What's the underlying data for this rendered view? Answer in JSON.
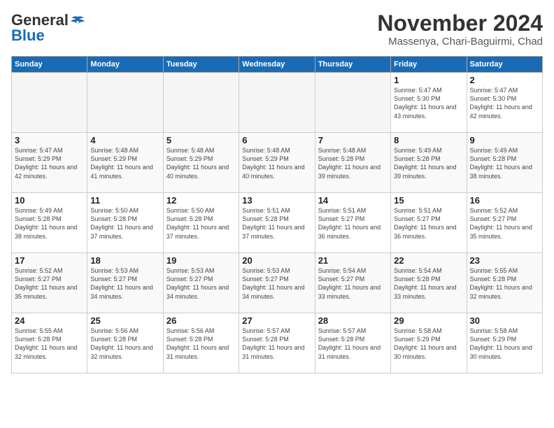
{
  "header": {
    "logo_general": "General",
    "logo_blue": "Blue",
    "title": "November 2024",
    "location": "Massenya, Chari-Baguirmi, Chad"
  },
  "days_of_week": [
    "Sunday",
    "Monday",
    "Tuesday",
    "Wednesday",
    "Thursday",
    "Friday",
    "Saturday"
  ],
  "weeks": [
    [
      {
        "day": "",
        "detail": ""
      },
      {
        "day": "",
        "detail": ""
      },
      {
        "day": "",
        "detail": ""
      },
      {
        "day": "",
        "detail": ""
      },
      {
        "day": "",
        "detail": ""
      },
      {
        "day": "1",
        "detail": "Sunrise: 5:47 AM\nSunset: 5:30 PM\nDaylight: 11 hours and 43 minutes."
      },
      {
        "day": "2",
        "detail": "Sunrise: 5:47 AM\nSunset: 5:30 PM\nDaylight: 11 hours and 42 minutes."
      }
    ],
    [
      {
        "day": "3",
        "detail": "Sunrise: 5:47 AM\nSunset: 5:29 PM\nDaylight: 11 hours and 42 minutes."
      },
      {
        "day": "4",
        "detail": "Sunrise: 5:48 AM\nSunset: 5:29 PM\nDaylight: 11 hours and 41 minutes."
      },
      {
        "day": "5",
        "detail": "Sunrise: 5:48 AM\nSunset: 5:29 PM\nDaylight: 11 hours and 40 minutes."
      },
      {
        "day": "6",
        "detail": "Sunrise: 5:48 AM\nSunset: 5:29 PM\nDaylight: 11 hours and 40 minutes."
      },
      {
        "day": "7",
        "detail": "Sunrise: 5:48 AM\nSunset: 5:28 PM\nDaylight: 11 hours and 39 minutes."
      },
      {
        "day": "8",
        "detail": "Sunrise: 5:49 AM\nSunset: 5:28 PM\nDaylight: 11 hours and 39 minutes."
      },
      {
        "day": "9",
        "detail": "Sunrise: 5:49 AM\nSunset: 5:28 PM\nDaylight: 11 hours and 38 minutes."
      }
    ],
    [
      {
        "day": "10",
        "detail": "Sunrise: 5:49 AM\nSunset: 5:28 PM\nDaylight: 11 hours and 38 minutes."
      },
      {
        "day": "11",
        "detail": "Sunrise: 5:50 AM\nSunset: 5:28 PM\nDaylight: 11 hours and 37 minutes."
      },
      {
        "day": "12",
        "detail": "Sunrise: 5:50 AM\nSunset: 5:28 PM\nDaylight: 11 hours and 37 minutes."
      },
      {
        "day": "13",
        "detail": "Sunrise: 5:51 AM\nSunset: 5:28 PM\nDaylight: 11 hours and 37 minutes."
      },
      {
        "day": "14",
        "detail": "Sunrise: 5:51 AM\nSunset: 5:27 PM\nDaylight: 11 hours and 36 minutes."
      },
      {
        "day": "15",
        "detail": "Sunrise: 5:51 AM\nSunset: 5:27 PM\nDaylight: 11 hours and 36 minutes."
      },
      {
        "day": "16",
        "detail": "Sunrise: 5:52 AM\nSunset: 5:27 PM\nDaylight: 11 hours and 35 minutes."
      }
    ],
    [
      {
        "day": "17",
        "detail": "Sunrise: 5:52 AM\nSunset: 5:27 PM\nDaylight: 11 hours and 35 minutes."
      },
      {
        "day": "18",
        "detail": "Sunrise: 5:53 AM\nSunset: 5:27 PM\nDaylight: 11 hours and 34 minutes."
      },
      {
        "day": "19",
        "detail": "Sunrise: 5:53 AM\nSunset: 5:27 PM\nDaylight: 11 hours and 34 minutes."
      },
      {
        "day": "20",
        "detail": "Sunrise: 5:53 AM\nSunset: 5:27 PM\nDaylight: 11 hours and 34 minutes."
      },
      {
        "day": "21",
        "detail": "Sunrise: 5:54 AM\nSunset: 5:27 PM\nDaylight: 11 hours and 33 minutes."
      },
      {
        "day": "22",
        "detail": "Sunrise: 5:54 AM\nSunset: 5:28 PM\nDaylight: 11 hours and 33 minutes."
      },
      {
        "day": "23",
        "detail": "Sunrise: 5:55 AM\nSunset: 5:28 PM\nDaylight: 11 hours and 32 minutes."
      }
    ],
    [
      {
        "day": "24",
        "detail": "Sunrise: 5:55 AM\nSunset: 5:28 PM\nDaylight: 11 hours and 32 minutes."
      },
      {
        "day": "25",
        "detail": "Sunrise: 5:56 AM\nSunset: 5:28 PM\nDaylight: 11 hours and 32 minutes."
      },
      {
        "day": "26",
        "detail": "Sunrise: 5:56 AM\nSunset: 5:28 PM\nDaylight: 11 hours and 31 minutes."
      },
      {
        "day": "27",
        "detail": "Sunrise: 5:57 AM\nSunset: 5:28 PM\nDaylight: 11 hours and 31 minutes."
      },
      {
        "day": "28",
        "detail": "Sunrise: 5:57 AM\nSunset: 5:28 PM\nDaylight: 11 hours and 31 minutes."
      },
      {
        "day": "29",
        "detail": "Sunrise: 5:58 AM\nSunset: 5:29 PM\nDaylight: 11 hours and 30 minutes."
      },
      {
        "day": "30",
        "detail": "Sunrise: 5:58 AM\nSunset: 5:29 PM\nDaylight: 11 hours and 30 minutes."
      }
    ]
  ]
}
